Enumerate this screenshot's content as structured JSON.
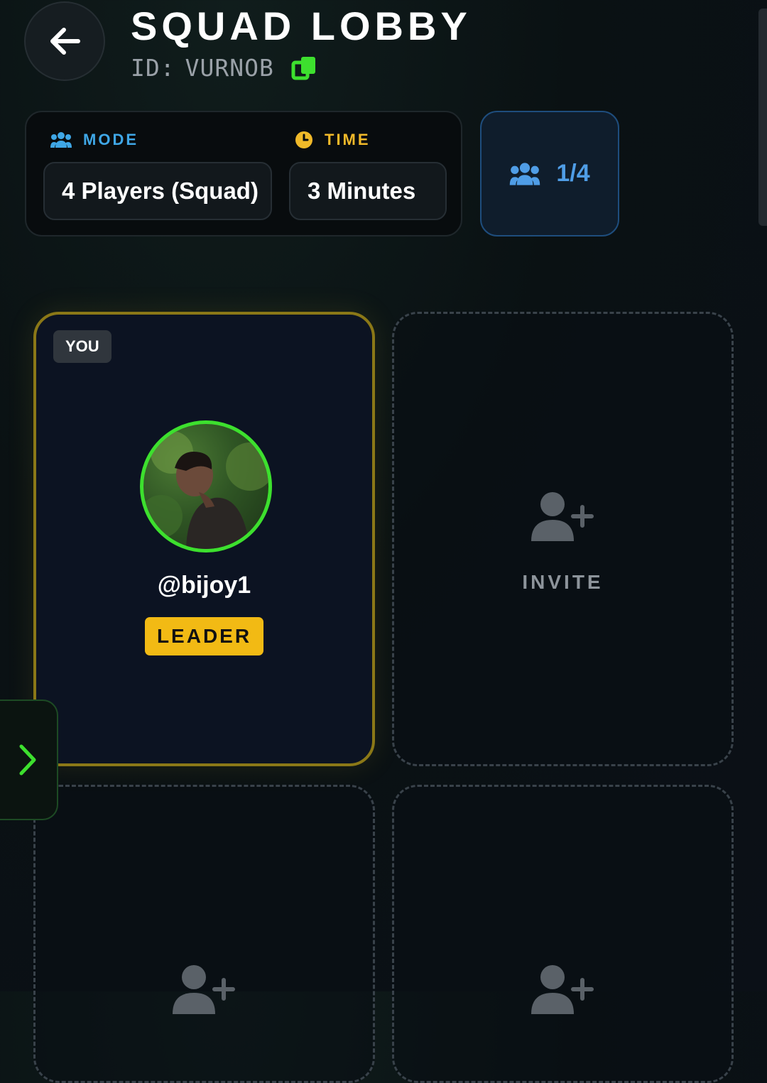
{
  "header": {
    "title": "SQUAD LOBBY",
    "id_label": "ID:",
    "id_value": "VURNOB",
    "icons": {
      "back": "arrow-left-icon",
      "copy": "copy-icon"
    }
  },
  "settings": {
    "mode": {
      "label": "MODE",
      "value": "4 Players (Squad)",
      "icon": "users-icon",
      "color": "#3fa7e6"
    },
    "time": {
      "label": "TIME",
      "value": "3 Minutes",
      "icon": "clock-icon",
      "color": "#f0b929"
    }
  },
  "player_count": {
    "text": "1/4",
    "current": 1,
    "max": 4,
    "icon": "users-icon",
    "color": "#4f9de6"
  },
  "slots": [
    {
      "type": "player",
      "badge": "YOU",
      "username": "@bijoy1",
      "role": "LEADER",
      "avatar": "user-photo"
    },
    {
      "type": "empty",
      "label": "INVITE",
      "icon": "user-plus-icon"
    },
    {
      "type": "empty",
      "label": "",
      "icon": "user-plus-icon"
    },
    {
      "type": "empty",
      "label": "",
      "icon": "user-plus-icon"
    }
  ],
  "side_panel": {
    "icon": "chevron-right-icon",
    "color": "#3de02e"
  },
  "colors": {
    "accent_green": "#3de02e",
    "leader_gold": "#f2ba14"
  }
}
